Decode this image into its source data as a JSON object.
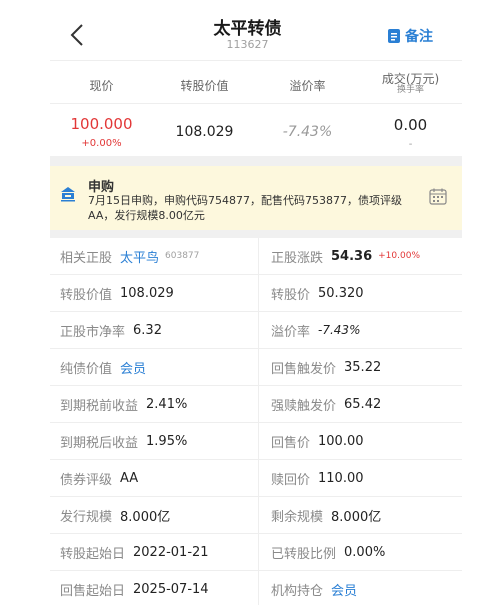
{
  "header": {
    "title": "太平转债",
    "code": "113627",
    "note_label": "备注"
  },
  "quote": {
    "headers": [
      "现价",
      "转股价值",
      "溢价率",
      "成交(万元)",
      "换手率"
    ],
    "price": "100.000",
    "price_change": "+0.00%",
    "conversion_value": "108.029",
    "premium_rate": "-7.43%",
    "volume": "0.00",
    "turnover": "-"
  },
  "banner": {
    "title": "申购",
    "text": "7月15日申购，申购代码754877，配售代码753877，债项评级AA，发行规模8.00亿元"
  },
  "details": {
    "related_stock_label": "相关正股",
    "related_stock_name": "太平鸟",
    "related_stock_code": "603877",
    "stock_change_label": "正股涨跌",
    "stock_price": "54.36",
    "stock_change_pct": "+10.00%",
    "conv_value_label": "转股价值",
    "conv_value": "108.029",
    "conv_price_label": "转股价",
    "conv_price": "50.320",
    "pb_label": "正股市净率",
    "pb": "6.32",
    "premium_label": "溢价率",
    "premium": "-7.43%",
    "bond_value_label": "纯债价值",
    "bond_value": "会员",
    "putback_trigger_label": "回售触发价",
    "putback_trigger": "35.22",
    "ytm_pre_label": "到期税前收益",
    "ytm_pre": "2.41%",
    "force_redeem_label": "强赎触发价",
    "force_redeem": "65.42",
    "ytm_post_label": "到期税后收益",
    "ytm_post": "1.95%",
    "putback_price_label": "回售价",
    "putback_price": "100.00",
    "rating_label": "债券评级",
    "rating": "AA",
    "redeem_price_label": "赎回价",
    "redeem_price": "110.00",
    "issue_size_label": "发行规模",
    "issue_size": "8.000亿",
    "remaining_size_label": "剩余规模",
    "remaining_size": "8.000亿",
    "conv_start_label": "转股起始日",
    "conv_start": "2022-01-21",
    "converted_ratio_label": "已转股比例",
    "converted_ratio": "0.00%",
    "putback_start_label": "回售起始日",
    "putback_start": "2025-07-14",
    "institution_label": "机构持仓",
    "institution": "会员"
  },
  "colors": {
    "accent": "#2a7fd4",
    "up_red": "#e23737",
    "banner_bg": "#fdf8dd"
  }
}
